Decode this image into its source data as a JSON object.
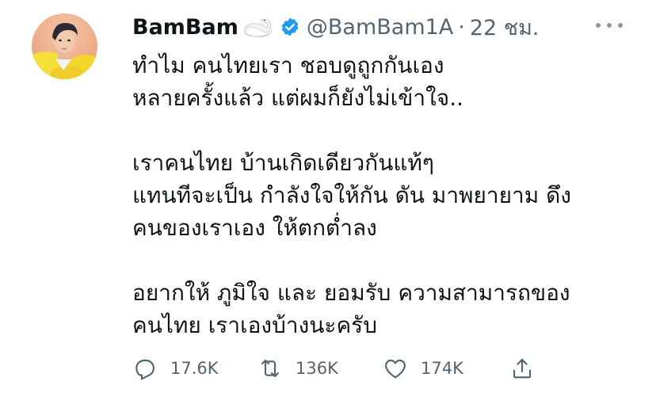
{
  "tweet": {
    "display_name": "BamBam",
    "handle": "@BamBam1A",
    "separator": "·",
    "time": "22 ชม.",
    "lines": [
      [
        "ทำไม คนไทยเรา ชอบดูถูกกันเอง",
        "หลายครั้งแล้ว แต่ผมก็ยังไม่เข้าใจ.."
      ],
      [
        "เราคนไทย บ้านเกิดเดียวกันแท้ๆ",
        "แทนทีจะเป็น กำลังใจให้กัน ดัน มาพยายาม ดึง",
        "คนของเราเอง ให้ตกต่ำลง"
      ],
      [
        "อยากให้ ภูมิใจ และ ยอมรับ ความสามารถของ",
        "คนไทย เราเองบ้างนะครับ"
      ]
    ]
  },
  "actions": {
    "reply_count": "17.6K",
    "retweet_count": "136K",
    "like_count": "174K"
  },
  "icons": {
    "verified": "verified-badge-icon",
    "swan": "swan-emoji-icon",
    "reply": "reply-icon",
    "retweet": "retweet-icon",
    "like": "heart-icon",
    "share": "share-icon",
    "more": "more-dots-icon"
  },
  "colors": {
    "verified": "#1d9bf0",
    "text": "#0f1419",
    "secondary": "#536471"
  }
}
